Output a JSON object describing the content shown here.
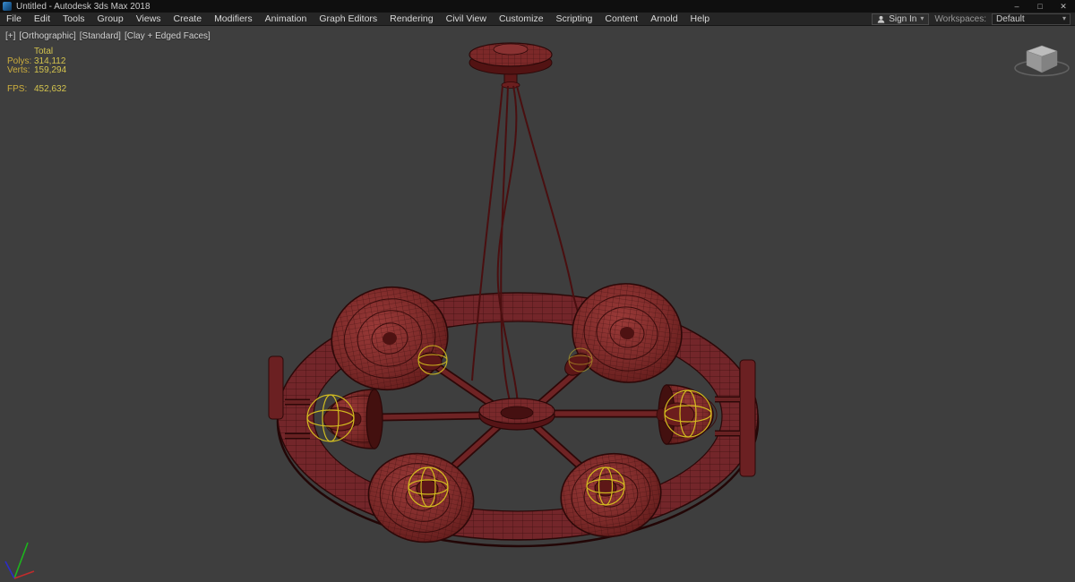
{
  "window": {
    "title": "Untitled - Autodesk 3ds Max 2018",
    "controls": {
      "minimize": "–",
      "maximize": "□",
      "close": "✕"
    }
  },
  "menubar": {
    "items": [
      "File",
      "Edit",
      "Tools",
      "Group",
      "Views",
      "Create",
      "Modifiers",
      "Animation",
      "Graph Editors",
      "Rendering",
      "Civil View",
      "Customize",
      "Scripting",
      "Content",
      "Arnold",
      "Help"
    ],
    "sign_in": {
      "label": "Sign In",
      "caret": "▾"
    },
    "workspaces": {
      "label": "Workspaces:",
      "value": "Default",
      "caret": "▾"
    }
  },
  "viewport": {
    "label_segments": [
      "[+]",
      "[Orthographic]",
      "[Standard]",
      "[Clay + Edged Faces]"
    ],
    "statistics": {
      "total_label": "Total",
      "rows": [
        {
          "label": "Polys:",
          "value": "314,112"
        },
        {
          "label": "Verts:",
          "value": "159,294"
        }
      ],
      "fps_label": "FPS:",
      "fps_value": "452,632"
    },
    "scene": {
      "object": "chandelier wireframe model, 6 lamp shades with photometric light gizmos",
      "render_style": "Clay + Edged Faces"
    }
  },
  "colors": {
    "titlebar_bg": "#0f0f0f",
    "menubar_bg": "#262626",
    "viewport_bg": "#3e3e3e",
    "model_red": "#76282a",
    "model_edge": "#2c0808",
    "gizmo_yellow": "#d8c31f",
    "stats_yellow": "#d4c44e"
  }
}
